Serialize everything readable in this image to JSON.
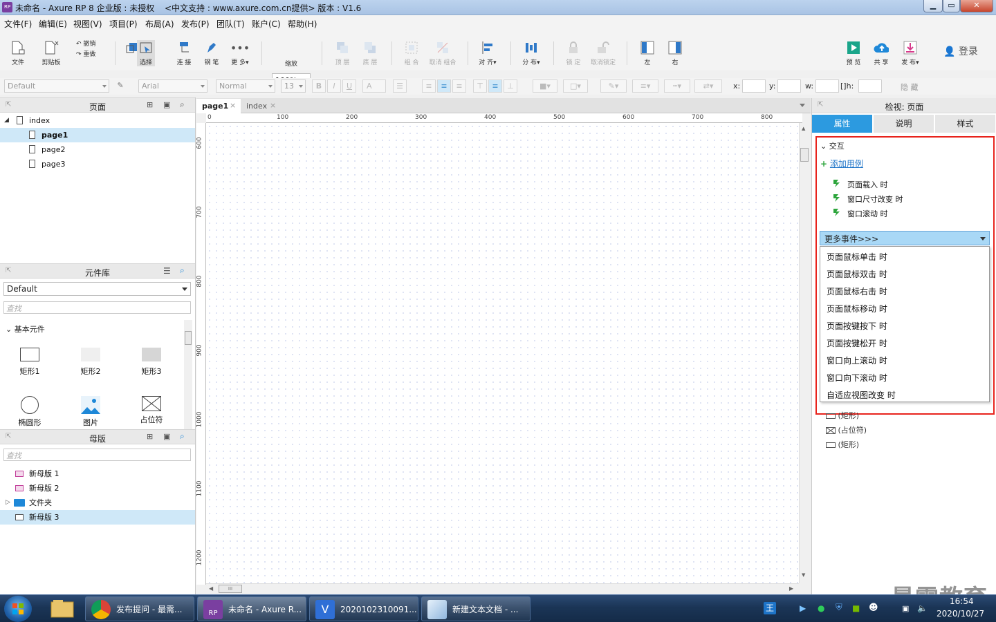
{
  "window": {
    "app_icon": "RP",
    "title": "未命名 - Axure RP 8 企业版 : 未授权",
    "subtitle": "<中文支持 : www.axure.com.cn提供> 版本 : V1.6",
    "minimize": "▁",
    "maximize": "▭",
    "close": "✕"
  },
  "menu": [
    "文件(F)",
    "编辑(E)",
    "视图(V)",
    "项目(P)",
    "布局(A)",
    "发布(P)",
    "团队(T)",
    "账户(C)",
    "帮助(H)"
  ],
  "toolbar": {
    "file": "文件",
    "clipboard": "剪贴板",
    "undo": "撤销",
    "redo": "重做",
    "select": "选择",
    "connect": "连 接",
    "pen": "钢 笔",
    "more": "更 多▾",
    "zoom_value": "100%",
    "zoom": "缩放",
    "top": "顶 层",
    "bottom": "底 层",
    "group": "组 合",
    "ungroup": "取消 组合",
    "align": "对 齐▾",
    "distribute": "分 布▾",
    "lock": "锁 定",
    "unlock": "取消锁定",
    "left": "左",
    "right": "右",
    "preview": "预 览",
    "share": "共 享",
    "publish": "发 布▾",
    "login": "登录"
  },
  "format": {
    "style": "Default",
    "font": "Arial",
    "weight": "Normal",
    "size": "13",
    "bold": "B",
    "italic": "I",
    "underline": "U",
    "font_color": "A",
    "x": "x:",
    "y": "y:",
    "w": "w:",
    "h": "h:",
    "hide": "隐 藏"
  },
  "pages_panel": {
    "title": "页面",
    "root": "index",
    "pages": [
      "page1",
      "page2",
      "page3"
    ],
    "selected": "page1"
  },
  "library_panel": {
    "title": "元件库",
    "library": "Default",
    "search_placeholder": "查找",
    "section": "基本元件",
    "widgets": [
      "矩形1",
      "矩形2",
      "矩形3",
      "椭圆形",
      "图片",
      "占位符"
    ]
  },
  "masters_panel": {
    "title": "母版",
    "search_placeholder": "查找",
    "items": [
      "新母版 1",
      "新母版 2",
      "文件夹",
      "新母版 3"
    ],
    "selected": "新母版 3"
  },
  "canvas": {
    "tabs": [
      "page1",
      "index"
    ],
    "active_tab": "page1",
    "ruler_top": [
      "0",
      "100",
      "200",
      "300",
      "400",
      "500",
      "600",
      "700",
      "800"
    ],
    "ruler_left": [
      "600",
      "700",
      "800",
      "900",
      "1000",
      "1100",
      "1200"
    ],
    "scroll_handle": "III"
  },
  "inspector": {
    "title": "检视: 页面",
    "tabs": [
      "属性",
      "说明",
      "样式"
    ],
    "active_tab": "属性",
    "section": "交互",
    "add_case": "添加用例",
    "events": [
      "页面载入 时",
      "窗口尺寸改变 时",
      "窗口滚动 时"
    ],
    "more_events": "更多事件>>>",
    "dropdown_options": [
      "页面鼠标单击 时",
      "页面鼠标双击 时",
      "页面鼠标右击 时",
      "页面鼠标移动 时",
      "页面按键按下 时",
      "页面按键松开 时",
      "窗口向上滚动 时",
      "窗口向下滚动 时",
      "自适应视图改变 时"
    ],
    "outline_items": [
      "(矩形)",
      "(占位符)",
      "(矩形)"
    ],
    "highlight_color": "#e8231c"
  },
  "taskbar": {
    "items": [
      "发布提问 - 最需...",
      "未命名 - Axure R...",
      "2020102310091...",
      "新建文本文档 - ..."
    ],
    "time": "16:54",
    "date": "2020/10/27",
    "ime": "王"
  },
  "watermark": "最需教育"
}
